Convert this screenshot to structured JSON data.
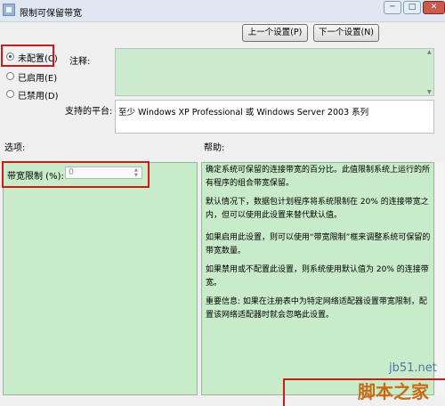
{
  "window": {
    "title": "限制可保留带宽",
    "min_glyph": "─",
    "max_glyph": "□",
    "close_glyph": "✕"
  },
  "nav": {
    "prev_label": "上一个设置(P)",
    "next_label": "下一个设置(N)"
  },
  "state_options": [
    {
      "label": "未配置(C)",
      "selected": true
    },
    {
      "label": "已启用(E)",
      "selected": false
    },
    {
      "label": "已禁用(D)",
      "selected": false
    }
  ],
  "comment": {
    "label": "注释:",
    "value": ""
  },
  "platform": {
    "label": "支持的平台:",
    "value": "至少 Windows XP Professional 或 Windows Server 2003 系列"
  },
  "options": {
    "label": "选项:",
    "bandwidth_label": "带宽限制 (%):",
    "bandwidth_value": "0"
  },
  "help": {
    "label": "帮助:",
    "paragraphs": [
      "确定系统可保留的连接带宽的百分比。此值限制系统上运行的所有程序的组合带宽保留。",
      "默认情况下，数据包计划程序将系统限制在 20% 的连接带宽之内，但可以使用此设置来替代默认值。",
      "如果启用此设置，则可以使用“带宽限制”框来调整系统可保留的带宽数量。",
      "如果禁用或不配置此设置，则系统使用默认值为 20% 的连接带宽。",
      "重要信息: 如果在注册表中为特定网络适配器设置带宽限制，配置该网络适配器时就会忽略此设置。"
    ]
  },
  "watermark": {
    "line1": "jb51.net",
    "line2": "脚本之家"
  },
  "colors": {
    "panel_green": "#c8ebc9",
    "highlight_red": "#d01818"
  }
}
